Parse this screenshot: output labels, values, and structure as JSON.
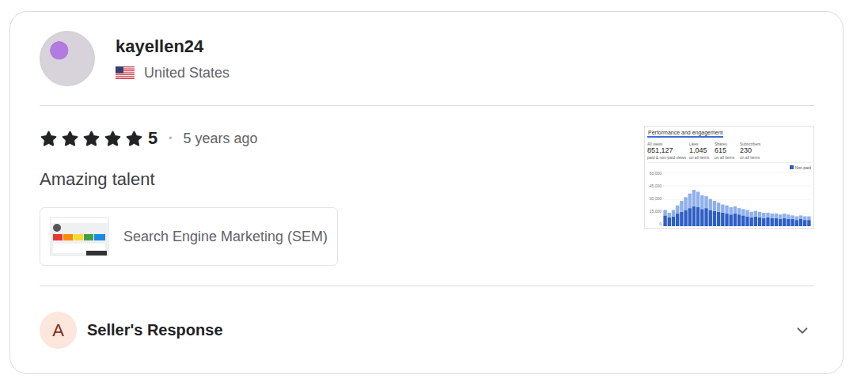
{
  "reviewer": {
    "username": "kayellen24",
    "country": "United States"
  },
  "review": {
    "stars": 5,
    "rating": "5",
    "separator": "•",
    "time": "5 years ago",
    "text": "Amazing talent",
    "tag": "Search Engine Marketing (SEM)"
  },
  "attachment": {
    "title": "Performance and engagement",
    "stats": [
      {
        "label": "All views",
        "value": "851,127",
        "note": "paid & non-paid views"
      },
      {
        "label": "Likes",
        "value": "1,045",
        "note": "on all items"
      },
      {
        "label": "Shares",
        "value": "615",
        "note": "on all items"
      },
      {
        "label": "Subscribers",
        "value": "230",
        "note": "on all items"
      }
    ],
    "legend": "Non-paid",
    "y_ticks": [
      "60,000",
      "45,000",
      "30,000",
      "15,000",
      "0"
    ],
    "y_max": 60000,
    "series": [
      {
        "name": "dark",
        "color": "#2f5fc4",
        "values": [
          12000,
          10000,
          11000,
          14000,
          16000,
          18000,
          20000,
          22000,
          21000,
          19000,
          20000,
          18000,
          17000,
          16000,
          15000,
          14000,
          13000,
          14000,
          13000,
          12000,
          11000,
          10000,
          11000,
          10000,
          9000,
          10000,
          9000,
          9000,
          8000,
          9000,
          8000,
          8000,
          7000,
          8000,
          7000,
          7000
        ]
      },
      {
        "name": "light",
        "color": "#8fb0ec",
        "values": [
          6000,
          5000,
          7000,
          9000,
          12000,
          14000,
          16000,
          18000,
          17000,
          15000,
          13000,
          12000,
          11000,
          10000,
          9000,
          9000,
          8000,
          8000,
          7000,
          7000,
          7000,
          6000,
          6000,
          6000,
          6000,
          5000,
          5000,
          5000,
          5000,
          5000,
          5000,
          4000,
          4000,
          4000,
          4000,
          4000
        ]
      }
    ]
  },
  "seller_response": {
    "avatar_letter": "A",
    "label": "Seller's Response",
    "expanded": false
  }
}
